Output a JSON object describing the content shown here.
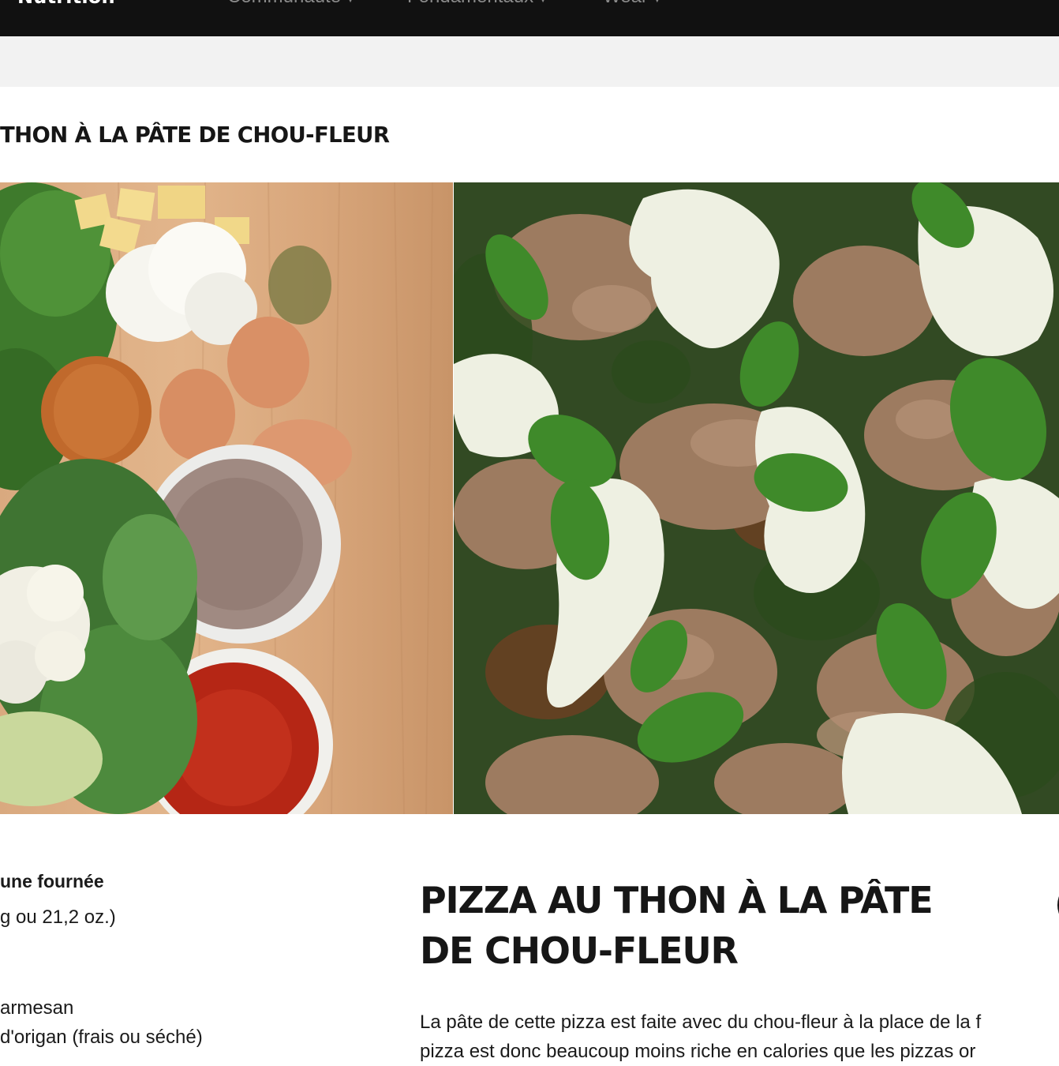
{
  "nav": {
    "brand": "Nutrition",
    "items": [
      {
        "label": "Communauté"
      },
      {
        "label": "Fondamentaux"
      },
      {
        "label": "Wear"
      }
    ]
  },
  "page": {
    "title": "THON À LA PÂTE DE CHOU-FLEUR"
  },
  "hero": {
    "left_alt": "ingredients-photo",
    "right_alt": "tuna-pizza-photo"
  },
  "ingredients": {
    "heading": "une fournée",
    "lines": [
      "g ou 21,2 oz.)",
      "armesan",
      "d'origan (frais ou séché)"
    ]
  },
  "article": {
    "title": "PIZZA AU THON À LA PÂTE DE CHOU-FLEUR",
    "body_lines": [
      "La pâte de cette pizza est faite avec du chou-fleur à la place de la f",
      "pizza est donc beaucoup moins riche en calories que les pizzas or"
    ],
    "edge_glyph": "("
  },
  "colors": {
    "nav_bg": "#111111",
    "subbar_bg": "#f2f2f2",
    "text": "#1a1a1a"
  }
}
